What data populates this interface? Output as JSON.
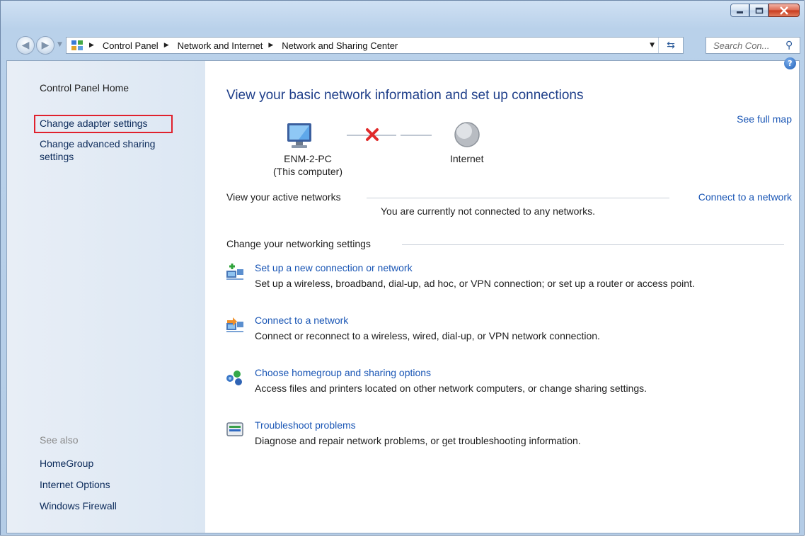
{
  "window": {
    "buttons": [
      "minimize",
      "maximize",
      "close"
    ]
  },
  "address": {
    "crumbs": [
      "Control Panel",
      "Network and Internet",
      "Network and Sharing Center"
    ],
    "search_placeholder": "Search Con..."
  },
  "left_pane": {
    "home": "Control Panel Home",
    "change_adapter": "Change adapter settings",
    "change_advanced": "Change advanced sharing settings",
    "see_also": "See also",
    "see_also_links": [
      "HomeGroup",
      "Internet Options",
      "Windows Firewall"
    ]
  },
  "main": {
    "title": "View your basic network information and set up connections",
    "see_full_map": "See full map",
    "computer_name": "ENM-2-PC",
    "computer_sub": "(This computer)",
    "internet_label": "Internet",
    "active_networks_label": "View your active networks",
    "connect_link": "Connect to a network",
    "not_connected": "You are currently not connected to any networks.",
    "change_settings_label": "Change your networking settings",
    "tasks": [
      {
        "title": "Set up a new connection or network",
        "desc": "Set up a wireless, broadband, dial-up, ad hoc, or VPN connection; or set up a router or access point."
      },
      {
        "title": "Connect to a network",
        "desc": "Connect or reconnect to a wireless, wired, dial-up, or VPN network connection."
      },
      {
        "title": "Choose homegroup and sharing options",
        "desc": "Access files and printers located on other network computers, or change sharing settings."
      },
      {
        "title": "Troubleshoot problems",
        "desc": "Diagnose and repair network problems, or get troubleshooting information."
      }
    ]
  },
  "colors": {
    "link": "#1a56b5",
    "title": "#1f3f8a",
    "highlight_box": "#e0212d",
    "left_pane_bg": "#e3ebf5"
  }
}
